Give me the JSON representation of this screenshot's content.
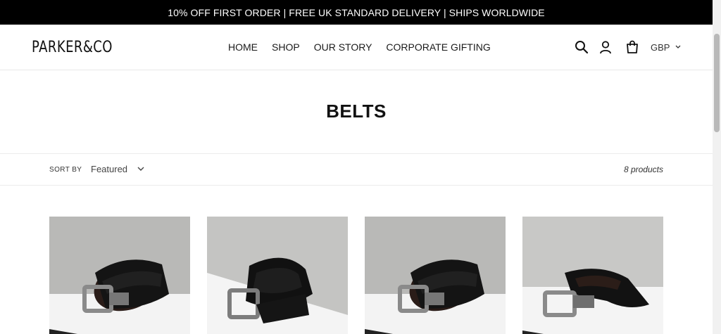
{
  "announcement": "10% OFF FIRST ORDER | FREE UK STANDARD DELIVERY | SHIPS WORLDWIDE",
  "brand": "PARKER&CO",
  "nav": [
    "HOME",
    "SHOP",
    "OUR STORY",
    "CORPORATE GIFTING"
  ],
  "header_icons": [
    "search-icon",
    "account-icon",
    "cart-icon"
  ],
  "currency": "GBP",
  "page_title": "BELTS",
  "filter": {
    "sort_label": "SORT BY",
    "sort_value": "Featured",
    "product_count": "8 products"
  },
  "products": [
    {
      "style": "reversible-black-brown"
    },
    {
      "style": "black-leather-dark-bg"
    },
    {
      "style": "reversible-black-brown"
    },
    {
      "style": "black-leather-angled"
    }
  ],
  "colors": {
    "announcement_bg": "#000000",
    "text": "#1a1a1a",
    "background": "#ffffff"
  }
}
